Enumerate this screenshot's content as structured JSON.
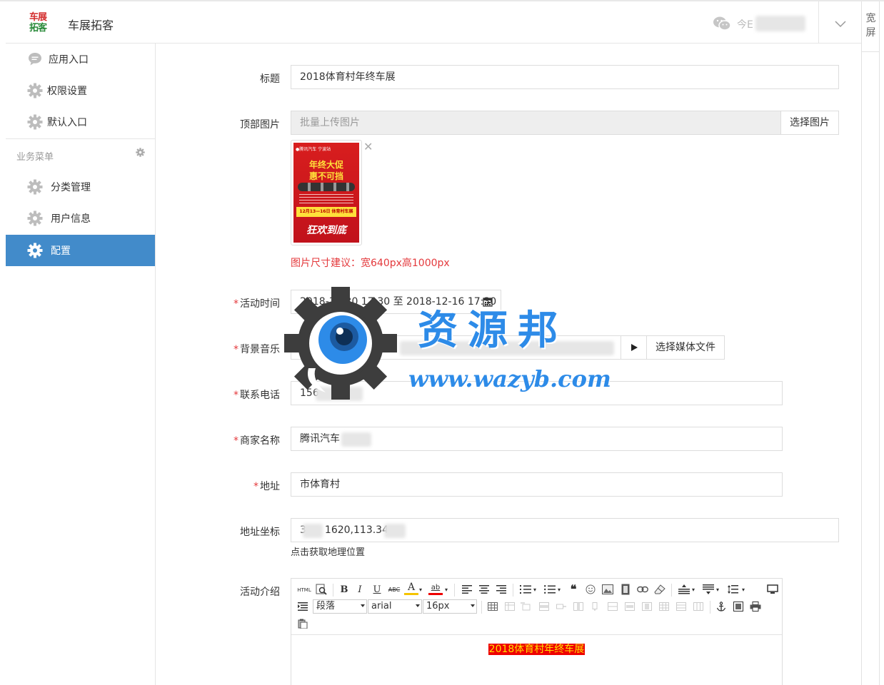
{
  "header": {
    "logo_line1": "车展",
    "logo_line2": "拓客",
    "app_title": "车展拓客",
    "user_prefix": "今E",
    "wide_label_1": "宽",
    "wide_label_2": "屏"
  },
  "sidebar": {
    "items": [
      {
        "label": "应用入口",
        "icon": "chat-icon"
      },
      {
        "label": "权限设置",
        "icon": "gear-icon"
      },
      {
        "label": "默认入口",
        "icon": "gear-icon"
      }
    ],
    "section_title": "业务菜单",
    "business_items": [
      {
        "label": "分类管理",
        "icon": "gear-icon"
      },
      {
        "label": "用户信息",
        "icon": "gear-icon"
      },
      {
        "label": "配置",
        "icon": "gear-icon",
        "active": true
      }
    ]
  },
  "form": {
    "title_label": "标题",
    "title_value": "2018体育村年终车展",
    "banner_label": "顶部图片",
    "banner_placeholder": "批量上传图片",
    "banner_button": "选择图片",
    "banner_hint": "图片尺寸建议：宽640px高1000px",
    "poster": {
      "top_text": "●腾讯汽车  宁波站",
      "line1": "年终大促",
      "line2": "惠不可挡",
      "band": "12月13—16日 体育村车展",
      "bottom": "狂欢到底"
    },
    "time_label": "活动时间",
    "time_value": "2018-11-30 17:30 至 2018-12-16 17:30",
    "music_label": "背景音乐",
    "music_value": "http:",
    "music_button": "选择媒体文件",
    "phone_label": "联系电话",
    "phone_value": "156",
    "merchant_label": "商家名称",
    "merchant_value": "腾讯汽车",
    "address_label": "地址",
    "address_value": "市体育村",
    "coords_label": "地址坐标",
    "coords_value_a": "3",
    "coords_value_b": "1620,113.34",
    "coords_hint": "点击获取地理位置",
    "intro_label": "活动介绍",
    "required_mark": "*"
  },
  "editor": {
    "html_btn": "HTML",
    "paragraph": "段落",
    "font": "arial",
    "size": "16px",
    "content": "2018体育村年终车展"
  },
  "watermark": {
    "title": "资源邦",
    "url": "www.wazyb.com"
  },
  "colors": {
    "active_nav": "#428bca",
    "required": "#e4393c",
    "watermark": "#2d8be8"
  }
}
